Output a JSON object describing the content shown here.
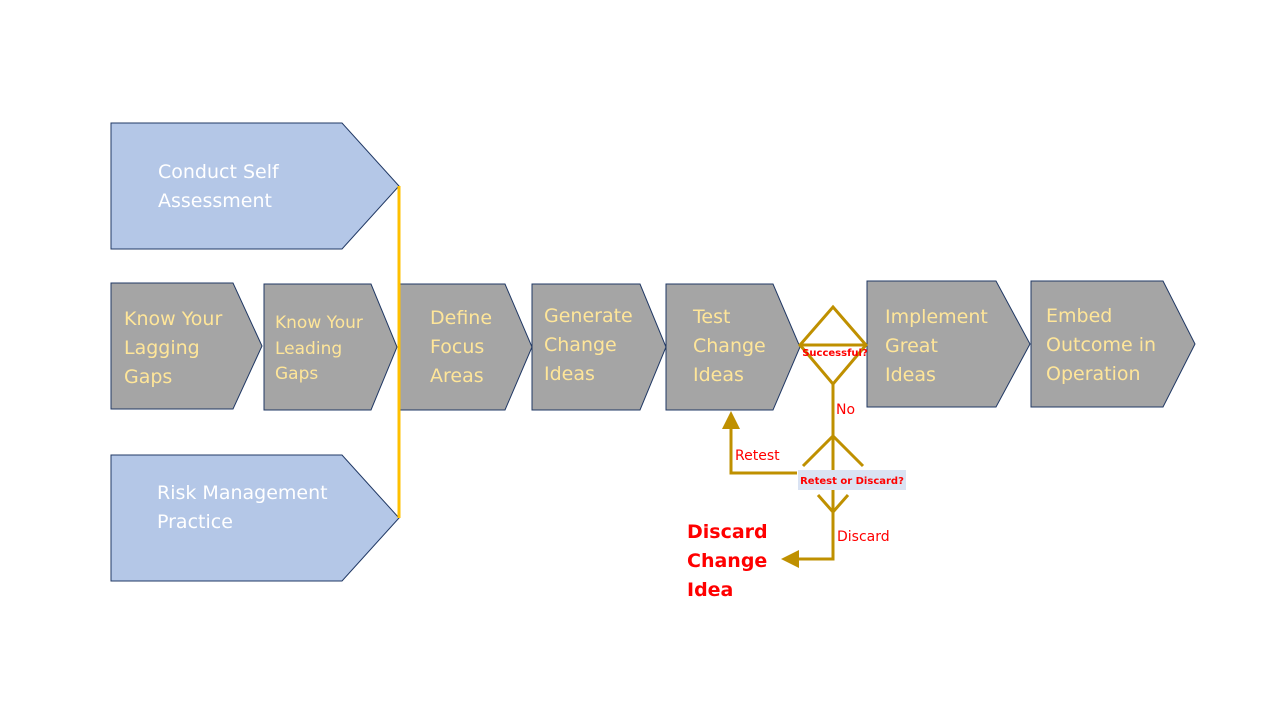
{
  "colors": {
    "blue_fill": "#b4c7e7",
    "gray_fill": "#a5a5a5",
    "outline": "#203864",
    "label_text": "#ffe699",
    "connector": "#ffc000",
    "flow": "#bf9000",
    "alert": "#ff0000",
    "decision_label_bg": "#dae3f3"
  },
  "inputs": {
    "top": [
      "Conduct Self",
      "Assessment"
    ],
    "bottom": [
      "Risk Management",
      "Practice"
    ]
  },
  "steps": [
    {
      "lines": [
        "Know Your",
        "Lagging",
        "Gaps"
      ]
    },
    {
      "lines": [
        "Know Your",
        "Leading",
        "Gaps"
      ]
    },
    {
      "lines": [
        "Define",
        "Focus",
        "Areas"
      ]
    },
    {
      "lines": [
        "Generate",
        "Change",
        "Ideas"
      ]
    },
    {
      "lines": [
        "Test",
        "Change",
        "Ideas"
      ]
    },
    {
      "lines": [
        "Implement",
        "Great",
        "Ideas"
      ]
    },
    {
      "lines": [
        "Embed",
        "Outcome in",
        "Operation"
      ]
    }
  ],
  "decision": {
    "question": "Successful?",
    "no_label": "No",
    "second_question": "Retest or Discard?",
    "retest_label": "Retest",
    "discard_label": "Discard",
    "outcome": [
      "Discard",
      "Change",
      "Idea"
    ]
  }
}
